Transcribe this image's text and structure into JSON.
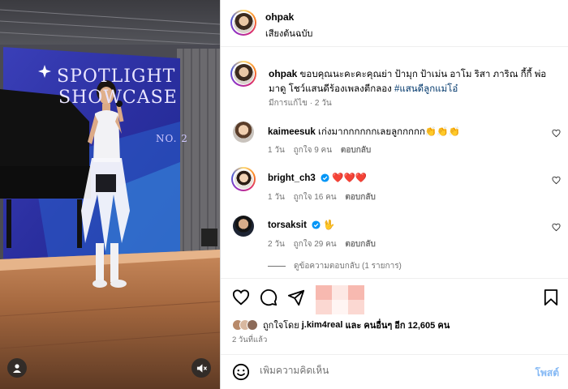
{
  "post": {
    "author": "ohpak",
    "audio_label": "เสียงต้นฉบับ",
    "banner_line1": "SPOTLIGHT",
    "banner_line2": "SHOWCASE",
    "banner_no": "NO. 2"
  },
  "caption": {
    "username": "ohpak",
    "text": "ขอบคุณนะคะคะคุณย่า ป้ามุก ป้าเม่น อาโม ริสา ภาริณ กี้กี้ พ่อ มาดู โชว์แสนดีร้องเพลงตีกลอง",
    "hashtag": "#แสนดีลูกแม่โอ๋",
    "meta": "มีการแก้ไข · 2 วัน"
  },
  "comments": [
    {
      "username": "kaimeesuk",
      "text": "เก่งมากกกกกกเลยลูกกกกก👏👏👏",
      "time": "1 วัน",
      "likes": "ถูกใจ 9 คน",
      "reply": "ตอบกลับ",
      "verified": false
    },
    {
      "username": "bright_ch3",
      "text": "❤️❤️❤️",
      "time": "1 วัน",
      "likes": "ถูกใจ 16 คน",
      "reply": "ตอบกลับ",
      "verified": true
    },
    {
      "username": "torsaksit",
      "text": "🖖",
      "time": "2 วัน",
      "likes": "ถูกใจ 29 คน",
      "reply": "ตอบกลับ",
      "verified": true
    }
  ],
  "view_replies": "ดูข้อความตอบกลับ (1 รายการ)",
  "likes": {
    "prefix": "ถูกใจโดย",
    "user": "j.kim4real",
    "middle": "และ",
    "others": "คนอื่นๆ อีก 12,605 คน"
  },
  "posted_time": "2 วันที่แล้ว",
  "comment_input": {
    "placeholder": "เพิ่มความคิดเห็น",
    "post_label": "โพสต์"
  },
  "colors": {
    "link": "#00376b",
    "verified": "#0095f6",
    "post_button": "#85b9f5",
    "muted": "#737373"
  },
  "icons": [
    "heart-icon",
    "comment-icon",
    "share-icon",
    "bookmark-icon",
    "emoji-icon",
    "user-tag-icon",
    "mute-icon",
    "verified-badge-icon"
  ]
}
